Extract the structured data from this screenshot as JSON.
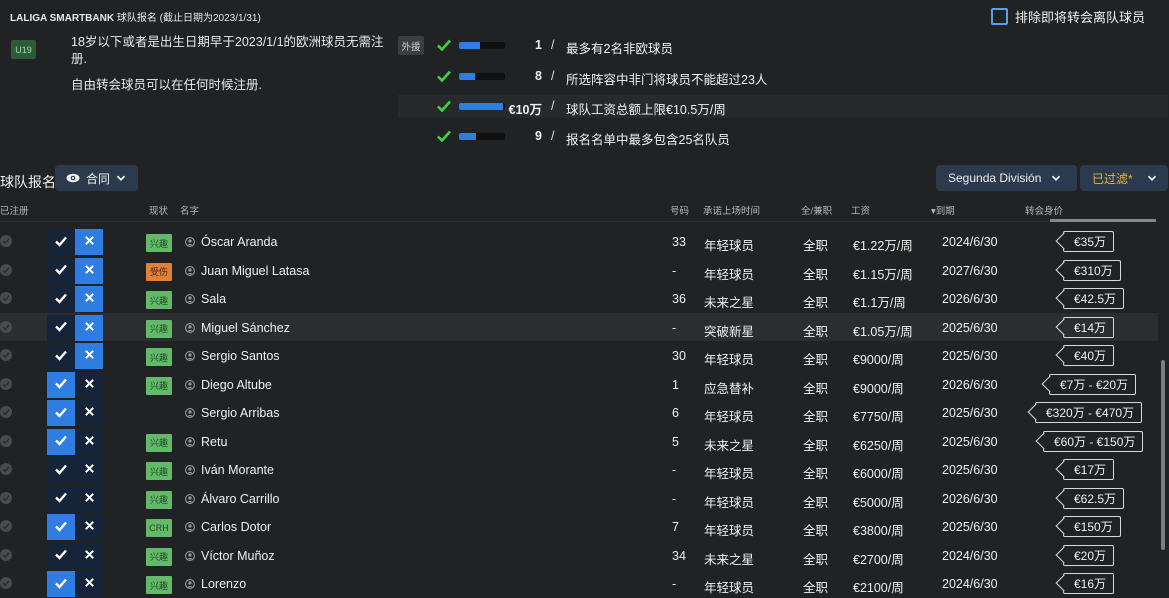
{
  "header": {
    "league": "LALIGA SMARTBANK",
    "subtitle": "球队报名 (截止日期为2023/1/31)",
    "exclude_label": "排除即将转会离队球员"
  },
  "notes": {
    "u19_badge": "U19",
    "note1": "18岁以下或者是出生日期早于2023/1/1的欧洲球员无需注册.",
    "note2": "自由转会球员可以在任何时候注册."
  },
  "rules": {
    "foreign_chip": "外援",
    "items": [
      {
        "value": "1",
        "fill_fraction": 0.45,
        "text": "最多有2名非欧球员"
      },
      {
        "value": "8",
        "fill_fraction": 0.35,
        "text": "所选阵容中非门将球员不能超过23人"
      },
      {
        "value": "€10万",
        "fill_fraction": 0.95,
        "text": "球队工资总额上限€10.5万/周"
      },
      {
        "value": "9",
        "fill_fraction": 0.36,
        "text": "报名名单中最多包含25名队员"
      }
    ]
  },
  "section": {
    "title": "球队报名",
    "view_label": "合同",
    "league_filter": "Segunda División",
    "filter_label": "已过滤*"
  },
  "columns": {
    "registered": "已注册",
    "status": "现状",
    "name": "名字",
    "number": "号码",
    "role": "承诺上场时间",
    "type": "全/兼职",
    "wage": "工资",
    "expiry": "到期",
    "value": "转会身价"
  },
  "players": [
    {
      "status": "兴趣",
      "status_color": "green",
      "name": "Óscar Aranda",
      "number": "33",
      "role": "年轻球员",
      "type": "全职",
      "wage": "€1.22万/周",
      "expiry": "2024/6/30",
      "value": "€35万",
      "tick": "off",
      "x": "on"
    },
    {
      "status": "受伤",
      "status_color": "orange",
      "name": "Juan Miguel Latasa",
      "number": "-",
      "role": "年轻球员",
      "type": "全职",
      "wage": "€1.15万/周",
      "expiry": "2027/6/30",
      "value": "€310万",
      "tick": "off",
      "x": "on"
    },
    {
      "status": "兴趣",
      "status_color": "green",
      "name": "Sala",
      "number": "36",
      "role": "未来之星",
      "type": "全职",
      "wage": "€1.1万/周",
      "expiry": "2026/6/30",
      "value": "€42.5万",
      "tick": "off",
      "x": "on"
    },
    {
      "status": "兴趣",
      "status_color": "green",
      "name": "Miguel Sánchez",
      "number": "-",
      "role": "突破新星",
      "type": "全职",
      "wage": "€1.05万/周",
      "expiry": "2025/6/30",
      "value": "€14万",
      "tick": "off",
      "x": "on"
    },
    {
      "status": "兴趣",
      "status_color": "green",
      "name": "Sergio Santos",
      "number": "30",
      "role": "年轻球员",
      "type": "全职",
      "wage": "€9000/周",
      "expiry": "2025/6/30",
      "value": "€40万",
      "tick": "off",
      "x": "on"
    },
    {
      "status": "兴趣",
      "status_color": "green",
      "name": "Diego Altube",
      "number": "1",
      "role": "应急替补",
      "type": "全职",
      "wage": "€9000/周",
      "expiry": "2026/6/30",
      "value": "€7万 - €20万",
      "tick": "on",
      "x": "off"
    },
    {
      "status": "",
      "status_color": "none",
      "name": "Sergio Arribas",
      "number": "6",
      "role": "年轻球员",
      "type": "全职",
      "wage": "€7750/周",
      "expiry": "2025/6/30",
      "value": "€320万 - €470万",
      "tick": "on",
      "x": "off"
    },
    {
      "status": "兴趣",
      "status_color": "green",
      "name": "Retu",
      "number": "5",
      "role": "未来之星",
      "type": "全职",
      "wage": "€6250/周",
      "expiry": "2025/6/30",
      "value": "€60万 - €150万",
      "tick": "on",
      "x": "off"
    },
    {
      "status": "兴趣",
      "status_color": "green",
      "name": "Iván Morante",
      "number": "-",
      "role": "年轻球员",
      "type": "全职",
      "wage": "€6000/周",
      "expiry": "2025/6/30",
      "value": "€17万",
      "tick": "off",
      "x": "off"
    },
    {
      "status": "兴趣",
      "status_color": "green",
      "name": "Álvaro Carrillo",
      "number": "-",
      "role": "年轻球员",
      "type": "全职",
      "wage": "€5000/周",
      "expiry": "2026/6/30",
      "value": "€62.5万",
      "tick": "off",
      "x": "off"
    },
    {
      "status": "CRH",
      "status_color": "green",
      "name": "Carlos Dotor",
      "number": "7",
      "role": "年轻球员",
      "type": "全职",
      "wage": "€3800/周",
      "expiry": "2025/6/30",
      "value": "€150万",
      "tick": "on",
      "x": "off"
    },
    {
      "status": "兴趣",
      "status_color": "green",
      "name": "Víctor Muñoz",
      "number": "34",
      "role": "未来之星",
      "type": "全职",
      "wage": "€2700/周",
      "expiry": "2024/6/30",
      "value": "€20万",
      "tick": "off",
      "x": "off"
    },
    {
      "status": "兴趣",
      "status_color": "green",
      "name": "Lorenzo",
      "number": "-",
      "role": "年轻球员",
      "type": "全职",
      "wage": "€2100/周",
      "expiry": "2024/6/30",
      "value": "€16万",
      "tick": "on",
      "x": "off"
    }
  ],
  "colors": {
    "accent": "#2f7de1",
    "check_green": "#3fd43f",
    "status_green": "#63b96a",
    "status_orange": "#e0813a",
    "filter_gold": "#e8b73c"
  }
}
